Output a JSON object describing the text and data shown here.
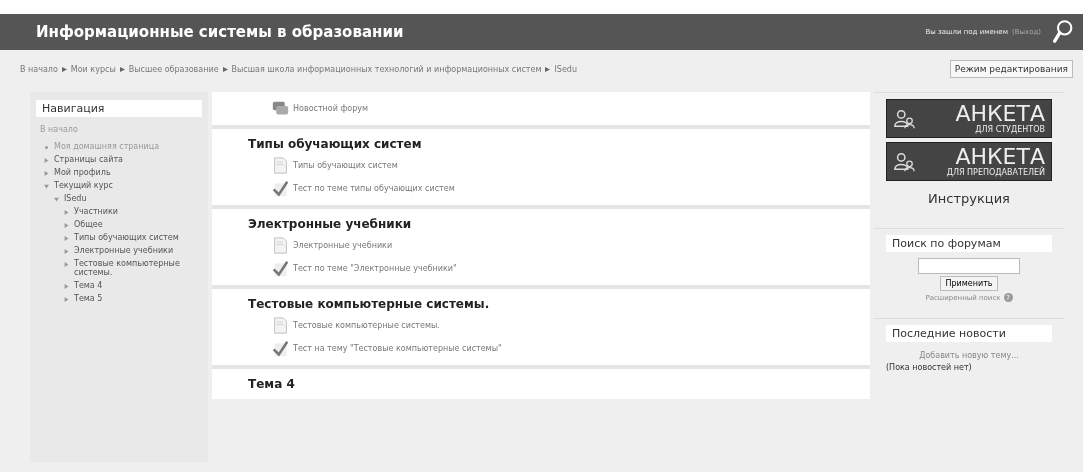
{
  "header": {
    "title": "Информационные системы в образовании",
    "login_text": "Вы зашли под именем",
    "logout": "(Выход)"
  },
  "breadcrumb": [
    "В начало",
    "Мои курсы",
    "Высшее образование",
    "Высшая школа информационных технологий и информационных систем",
    "ISedu"
  ],
  "edit_button": "Режим редактирования",
  "navigation": {
    "title": "Навигация",
    "home": "В начало",
    "items": [
      {
        "label": "Моя домашняя страница",
        "kind": "leaf"
      },
      {
        "label": "Страницы сайта",
        "kind": "branch",
        "expanded": false
      },
      {
        "label": "Мой профиль",
        "kind": "branch",
        "expanded": false
      },
      {
        "label": "Текущий курс",
        "kind": "branch",
        "expanded": true,
        "children": [
          {
            "label": "ISedu",
            "kind": "branch",
            "expanded": true,
            "children": [
              {
                "label": "Участники",
                "kind": "branch",
                "expanded": false
              },
              {
                "label": "Общее",
                "kind": "branch",
                "expanded": false
              },
              {
                "label": "Типы обучающих систем",
                "kind": "branch",
                "expanded": false
              },
              {
                "label": "Электронные учебники",
                "kind": "branch",
                "expanded": false
              },
              {
                "label": "Тестовые компьютерные системы.",
                "kind": "branch",
                "expanded": false
              },
              {
                "label": "Тема 4",
                "kind": "branch",
                "expanded": false
              },
              {
                "label": "Тема 5",
                "kind": "branch",
                "expanded": false
              }
            ]
          }
        ]
      }
    ]
  },
  "sections": [
    {
      "items": [
        {
          "kind": "forum",
          "label": "Новостной форум"
        }
      ]
    },
    {
      "title": "Типы обучающих систем",
      "items": [
        {
          "kind": "page",
          "label": "Типы обучающих систем"
        },
        {
          "kind": "quiz",
          "label": "Тест по теме типы обучающих систем"
        }
      ]
    },
    {
      "title": "Электронные учебники",
      "items": [
        {
          "kind": "page",
          "label": "Электронные учебники"
        },
        {
          "kind": "quiz",
          "label": "Тест по теме \"Электронные учебники\""
        }
      ]
    },
    {
      "title": "Тестовые компьютерные системы.",
      "items": [
        {
          "kind": "page",
          "label": "Тестовые компьютерные системы."
        },
        {
          "kind": "quiz",
          "label": "Тест на тему \"Тестовые компьютерные системы\""
        }
      ]
    },
    {
      "title": "Тема 4"
    }
  ],
  "banners": [
    {
      "big": "АНКЕТА",
      "small": "ДЛЯ СТУДЕНТОВ"
    },
    {
      "big": "АНКЕТА",
      "small": "ДЛЯ ПРЕПОДАВАТЕЛЕЙ"
    }
  ],
  "instruction": "Инструкция",
  "forum_search": {
    "title": "Поиск по форумам",
    "button": "Применить",
    "advanced": "Расширенный поиск",
    "help": "?"
  },
  "news": {
    "title": "Последние новости",
    "add": "Добавить новую тему...",
    "empty": "(Пока новостей нет)"
  }
}
